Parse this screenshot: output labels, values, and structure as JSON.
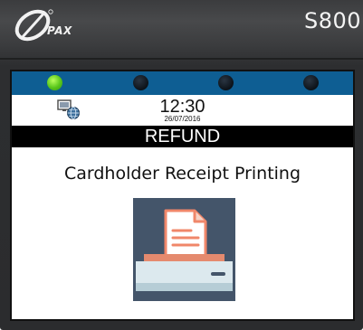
{
  "device": {
    "brand": "PAX",
    "model": "S800"
  },
  "status": {
    "leds": [
      "green",
      "off",
      "off",
      "off"
    ],
    "network_icon": "network-globe-icon"
  },
  "clock": {
    "time": "12:30",
    "date": "26/07/2016"
  },
  "screen": {
    "title": "REFUND",
    "message": "Cardholder Receipt Printing",
    "illustration": "printer-receipt-icon"
  },
  "colors": {
    "status_bar": "#0e5e93",
    "title_bar": "#000000",
    "led_active": "#57c51a",
    "illustration_bg": "#44556a",
    "receipt_accent": "#f0876a"
  }
}
